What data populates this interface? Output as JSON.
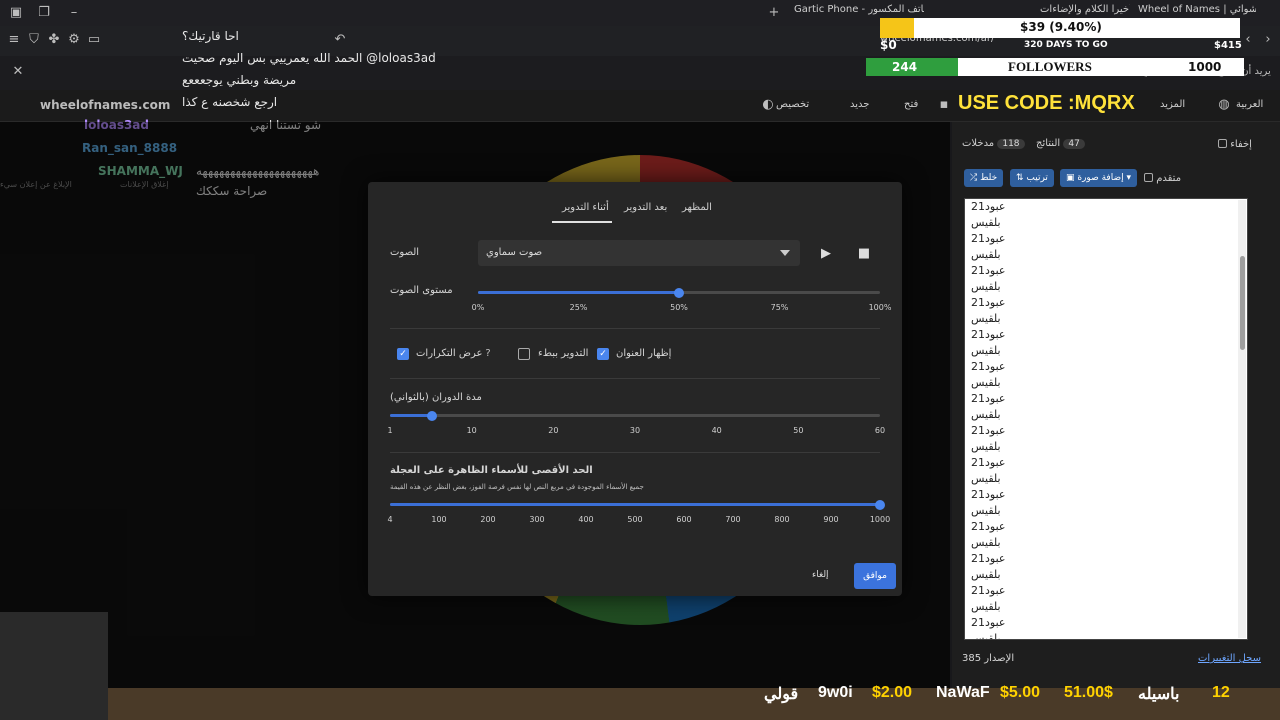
{
  "browser": {
    "tabs": [
      {
        "label": "Gartic Phone - لعبة الهاتف المكسور"
      },
      {
        "label": "أخيرا الكلام والإضاءات"
      },
      {
        "label": "Wheel of Names | الاسم العشوائي"
      }
    ],
    "url": "wheelofnames.com/ar/",
    "infobar_text": "Brave يريد أن يصبح متصفحك التلقائي"
  },
  "stream": {
    "goal_text": "$39 (9.40%)",
    "goal_fraction": 0.094,
    "days_to_go": "320 DAYS TO GO",
    "goal_min": "$0",
    "goal_max": "$415",
    "followers_count": "244",
    "followers_label": "FOLLOWERS",
    "followers_target": "1000",
    "followers_fraction": 0.244,
    "use_code": "USE CODE :MQRX"
  },
  "chat": {
    "messages": [
      {
        "name": "",
        "text": "احا قارتيك؟"
      },
      {
        "name": "",
        "text": "الحمد الله يعمرييي بس اليوم صحيت @loloas3ad"
      },
      {
        "name": "",
        "text": "مريضة وبطني يوجعععع"
      },
      {
        "name": "wheelofnames.com",
        "text": "ارجع شخصنه ع كذا"
      },
      {
        "name": "loloas3ad",
        "text": "شو تستنا انهي"
      },
      {
        "name": "Ran_san_8888",
        "text": ""
      },
      {
        "name": "SHAMMA_WJ",
        "text": "هههههههههههههههههههههه"
      },
      {
        "name": "",
        "text": "صراحة سككك"
      }
    ],
    "report_label": "الإبلاغ عن إعلان سيء",
    "close_ad_label": "إغلاق الإعلانات"
  },
  "appbar": {
    "items": [
      "المزيد",
      "فتح",
      "جديد",
      "تخصيص",
      "العربية"
    ]
  },
  "side_panel": {
    "tab_entries": "مدخلات",
    "entries_count": "118",
    "tab_results": "النتائج",
    "results_count": "47",
    "hide_label": "إخفاء",
    "shuffle_label": "خلط",
    "sort_label": "ترتيب",
    "add_image_label": "إضافة صورة",
    "advanced_label": "متقدم",
    "entries": [
      "عبود21",
      "بلقيس",
      "عبود21",
      "بلقيس",
      "عبود21",
      "بلقيس",
      "عبود21",
      "بلقيس",
      "عبود21",
      "بلقيس",
      "عبود21",
      "بلقيس",
      "عبود21",
      "بلقيس",
      "عبود21",
      "بلقيس",
      "عبود21",
      "بلقيس",
      "عبود21",
      "بلقيس",
      "عبود21",
      "بلقيس",
      "عبود21",
      "بلقيس",
      "عبود21",
      "بلقيس",
      "عبود21",
      "بلقيس"
    ],
    "version_label": "الإصدار 385",
    "changelog_label": "سجل التغييرات"
  },
  "dialog": {
    "tabs": [
      "أثناء التدوير",
      "بعد التدوير",
      "المظهر"
    ],
    "sound_label": "الصوت",
    "sound_value": "صوت سماوي",
    "volume_label": "مستوى الصوت",
    "volume_fraction": 0.5,
    "volume_ticks": [
      "0%",
      "25%",
      "50%",
      "75%",
      "100%"
    ],
    "checkboxes": [
      {
        "label": "عرض التكرارات",
        "checked": true
      },
      {
        "label": "التدوير ببطء",
        "checked": false
      },
      {
        "label": "إظهار العنوان",
        "checked": true
      }
    ],
    "spin_label": "مدة الدوران (بالثواني)",
    "spin_value": 6,
    "spin_ticks": [
      "1",
      "10",
      "20",
      "30",
      "40",
      "50",
      "60"
    ],
    "max_names_label": "الحد الأقصى للأسماء الظاهرة على العجلة",
    "max_names_hint": "جميع الأسماء الموجودة في مربع النص لها نفس فرصة الفوز، بغض النظر عن هذه القيمة",
    "max_names_value": 1000,
    "max_names_ticks": [
      "4",
      "100",
      "200",
      "300",
      "400",
      "500",
      "600",
      "700",
      "800",
      "900",
      "1000"
    ],
    "ok_label": "موافق",
    "cancel_label": "إلغاء"
  },
  "ticker": {
    "items": [
      {
        "text": "قولي",
        "color": "#ffffff"
      },
      {
        "text": "9w0i",
        "color": "#ffffff"
      },
      {
        "text": "$2.00",
        "color": "#ffd200"
      },
      {
        "text": "NaWaF",
        "color": "#ffffff"
      },
      {
        "text": "$5.00",
        "color": "#ffd200"
      },
      {
        "text": "51.00$",
        "color": "#ffd200"
      },
      {
        "text": "باسيله",
        "color": "#ffffff"
      },
      {
        "text": "12",
        "color": "#ffd200"
      }
    ]
  },
  "colors": {
    "accent": "#3b73dd",
    "goal": "#f5c518",
    "followers": "#2f9e3e",
    "code": "#ffe23a"
  }
}
